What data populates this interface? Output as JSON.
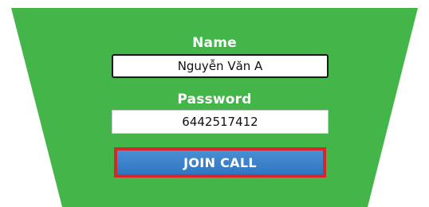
{
  "form": {
    "name_label": "Name",
    "name_value": "Nguyễn Văn A",
    "password_label": "Password",
    "password_value": "6442517412",
    "join_label": "JOIN CALL"
  },
  "colors": {
    "panel": "#43b549",
    "button": "#3b82cc",
    "button_border": "#d6262c",
    "label_text": "#ffffff"
  }
}
